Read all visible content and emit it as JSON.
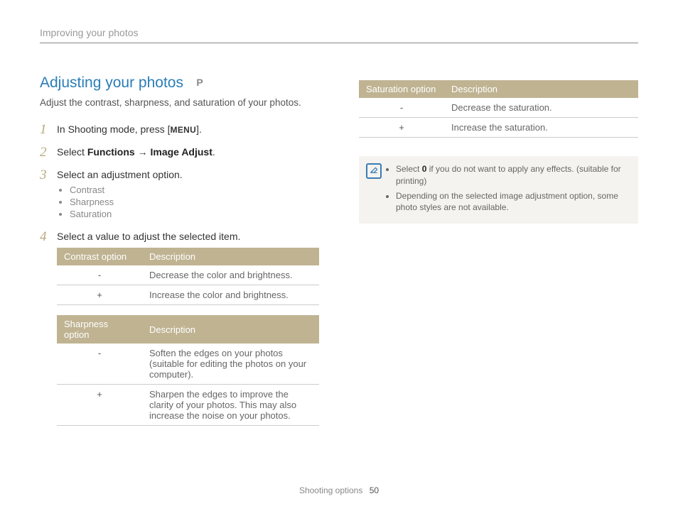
{
  "header": {
    "breadcrumb": "Improving your photos"
  },
  "section": {
    "title": "Adjusting your photos",
    "mode": "P",
    "intro": "Adjust the contrast, sharpness, and saturation of your photos."
  },
  "steps": {
    "s1_a": "In Shooting mode, press [",
    "s1_menu": "MENU",
    "s1_b": "].",
    "s2_a": "Select ",
    "s2_b1": "Functions",
    "s2_arrow": " → ",
    "s2_b2": "Image Adjust",
    "s2_c": ".",
    "s3": "Select an adjustment option.",
    "s3_items": {
      "a": "Contrast",
      "b": "Sharpness",
      "c": "Saturation"
    },
    "s4": "Select a value to adjust the selected item."
  },
  "tables": {
    "contrast": {
      "h1": "Contrast option",
      "h2": "Description",
      "r1o": "-",
      "r1d": "Decrease the color and brightness.",
      "r2o": "+",
      "r2d": "Increase the color and brightness."
    },
    "sharpness": {
      "h1": "Sharpness option",
      "h2": "Description",
      "r1o": "-",
      "r1d": "Soften the edges on your photos (suitable for editing the photos on your computer).",
      "r2o": "+",
      "r2d": "Sharpen the edges to improve the clarity of your photos. This may also increase the noise on your photos."
    },
    "saturation": {
      "h1": "Saturation option",
      "h2": "Description",
      "r1o": "-",
      "r1d": "Decrease the saturation.",
      "r2o": "+",
      "r2d": "Increase the saturation."
    }
  },
  "note": {
    "i1a": "Select ",
    "i1b": "0",
    "i1c": " if you do not want to apply any effects. (suitable for printing)",
    "i2": "Depending on the selected image adjustment option, some photo styles are not available."
  },
  "footer": {
    "section": "Shooting options",
    "page": "50"
  }
}
